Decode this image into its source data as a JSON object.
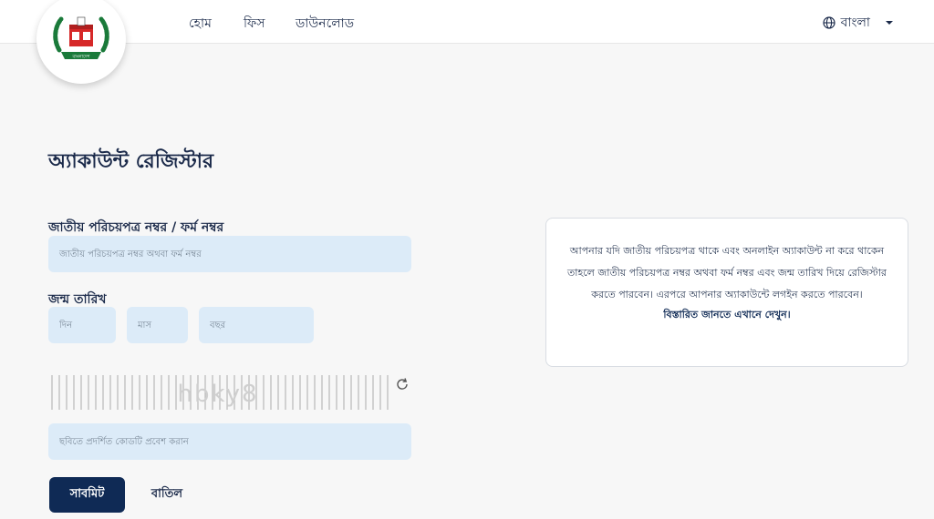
{
  "header": {
    "logo_text": "বাংলাদেশ",
    "nav": [
      {
        "label": "হোম"
      },
      {
        "label": "ফিস"
      },
      {
        "label": "ডাউনলোড"
      }
    ],
    "language": {
      "label": "বাংলা",
      "icon": "globe-icon"
    }
  },
  "form": {
    "title": "অ্যাকাউন্ট রেজিস্টার",
    "nid_label": "জাতীয় পরিচয়পত্র নম্বর / ফর্ম নম্বর",
    "nid_placeholder": "জাতীয় পরিচয়পত্র নম্বর অথবা ফর্ম নম্বর",
    "dob_label": "জন্ম তারিখ",
    "day_placeholder": "দিন",
    "month_placeholder": "মাস",
    "year_placeholder": "বছর",
    "captcha_text": "hbky8",
    "captcha_placeholder": "ছবিতে প্রদর্শিত কোডটি প্রবেশ করান",
    "submit_label": "সাবমিট",
    "cancel_label": "বাতিল"
  },
  "info": {
    "text": "আপনার যদি জাতীয় পরিচয়পত্র থাকে এবং অনলাইন অ্যাকাউন্ট না করে থাকেন তাহলে জাতীয় পরিচয়পত্র নম্বর অথবা ফর্ম নম্বর এবং জন্ম তারিখ দিয়ে রেজিস্টার করতে পারবেন। এরপরে আপনার অ্যাকাউন্টে লগইন করতে পারবেন।",
    "link": "বিস্তারিত জানতে এখানে দেখুন।"
  },
  "colors": {
    "primary": "#0f2a55",
    "input_bg": "#dcebf8",
    "logo_green": "#1a7a3a",
    "logo_red": "#d62828"
  }
}
